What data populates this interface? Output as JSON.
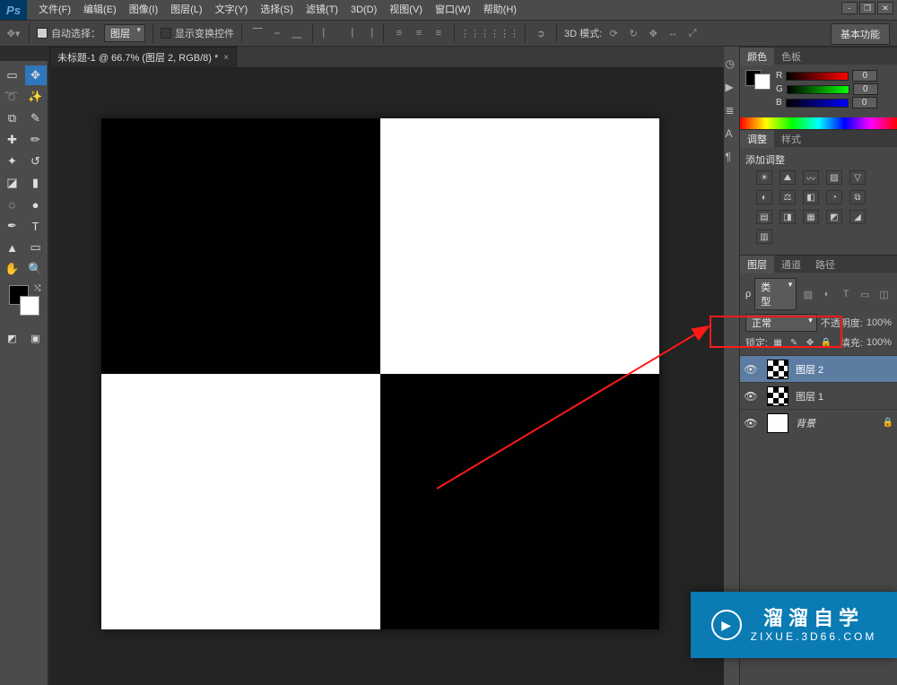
{
  "app": {
    "logo": "Ps"
  },
  "menu": [
    "文件(F)",
    "编辑(E)",
    "图像(I)",
    "图层(L)",
    "文字(Y)",
    "选择(S)",
    "滤镜(T)",
    "3D(D)",
    "视图(V)",
    "窗口(W)",
    "帮助(H)"
  ],
  "options": {
    "auto_select_checked": true,
    "auto_select_label": "自动选择：",
    "auto_select_target": "图层",
    "show_transform_checked": false,
    "show_transform_label": "显示变换控件",
    "mode3d_label": "3D 模式:",
    "essentials": "基本功能"
  },
  "document": {
    "tab_title": "未标题-1 @ 66.7% (图层 2, RGB/8) *"
  },
  "colorPanel": {
    "tabs": [
      "颜色",
      "色板"
    ],
    "channels": [
      {
        "name": "R",
        "value": "0"
      },
      {
        "name": "G",
        "value": "0"
      },
      {
        "name": "B",
        "value": "0"
      }
    ]
  },
  "adjustPanel": {
    "tabs": [
      "调整",
      "样式"
    ],
    "title": "添加调整"
  },
  "layersPanel": {
    "tabs": [
      "图层",
      "通道",
      "路径"
    ],
    "kind_label": "类型",
    "blend_mode": "正常",
    "opacity_label": "不透明度:",
    "opacity_value": "100%",
    "lock_label": "锁定:",
    "fill_label": "填充:",
    "fill_value": "100%",
    "layers": [
      {
        "visible": true,
        "thumb": "checker",
        "name": "图层 2",
        "selected": true
      },
      {
        "visible": true,
        "thumb": "checker",
        "name": "图层 1",
        "selected": false
      },
      {
        "visible": true,
        "thumb": "plain",
        "name": "背景",
        "selected": false,
        "locked": true
      }
    ]
  },
  "watermark": {
    "big": "溜溜自学",
    "small": "ZIXUE.3D66.COM"
  }
}
